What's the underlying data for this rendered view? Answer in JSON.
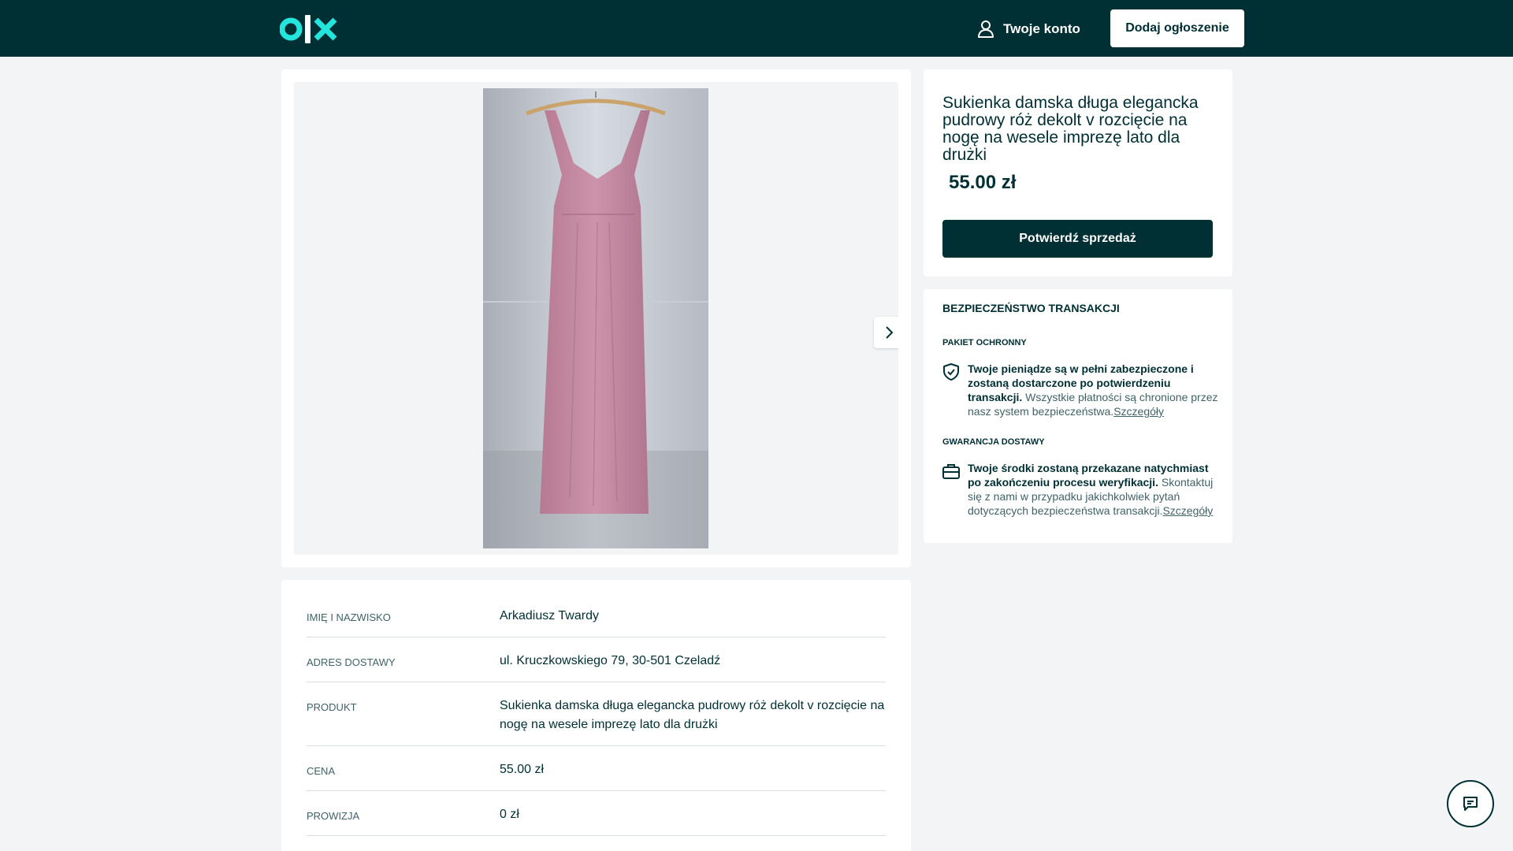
{
  "header": {
    "logo_text": "olx",
    "account_label": "Twoje konto",
    "add_button_label": "Dodaj ogłoszenie"
  },
  "gallery": {
    "photo_alt": "pink-dress-photo",
    "next_icon": "chevron-right-icon"
  },
  "listing": {
    "title": "Sukienka damska długa elegancka pudrowy róż dekolt v rozcięcie na nogę na wesele imprezę lato dla drużki",
    "price": "55.00 zł",
    "confirm_button_label": "Potwierdź sprzedaż"
  },
  "details": {
    "rows": [
      {
        "label": "IMIĘ I NAZWISKO",
        "value": "Arkadiusz Twardy"
      },
      {
        "label": "ADRES DOSTAWY",
        "value": "ul. Kruczkowskiego 79, 30-501 Czeladź"
      },
      {
        "label": "PRODUKT",
        "value": "Sukienka damska długa elegancka pudrowy róż dekolt v rozcięcie na nogę na wesele imprezę lato dla drużki"
      },
      {
        "label": "CENA",
        "value": "55.00 zł"
      },
      {
        "label": "PROWIZJA",
        "value": "0 zł"
      }
    ]
  },
  "security": {
    "title": "BEZPIECZEŃSTWO TRANSAKCJI",
    "package": {
      "subtitle": "PAKIET OCHRONNY",
      "bold": "Twoje pieniądze są w pełni zabezpieczone i zostaną dostarczone po potwierdzeniu transakcji.",
      "text": " Wszystkie płatności są chronione przez nasz system bezpieczeństwa.",
      "link": "Szczegóły"
    },
    "delivery": {
      "subtitle": "GWARANCJA DOSTAWY",
      "bold": "Twoje środki zostaną przekazane natychmiast po zakończeniu procesu weryfikacji.",
      "text": " Skontaktuj się z nami w przypadku jakichkolwiek pytań dotyczących bezpieczeństwa transakcji.",
      "link": "Szczegóły"
    }
  },
  "colors": {
    "brand_dark": "#002f34",
    "brand_teal": "#23e5db",
    "background": "#f2f4f5"
  }
}
